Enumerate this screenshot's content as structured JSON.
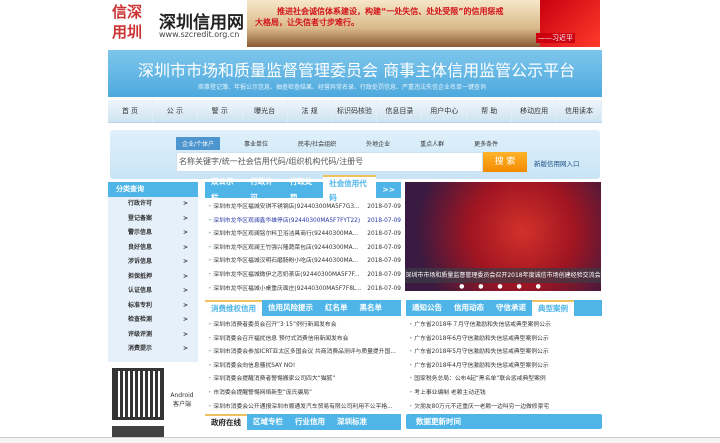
{
  "logo": {
    "seal": "信深用圳",
    "name": "深圳信用网",
    "url": "www.szcredit.org.cn"
  },
  "banner": {
    "line1": "推进社会诚信体系建设，构建“一处失信、处处受限”的信用惩戒",
    "line2": "大格局，让失信者寸步难行。",
    "sign": "——习近平"
  },
  "title": {
    "main": "深圳市市场和质量监督管理委员会 商事主体信用监管公示平台",
    "sub": "商事登记簿、年报公示信息、抽查检查结果、经营异常名录、行政处罚信息、严重违法失信企业名单一键查询"
  },
  "nav": [
    "首 页",
    "公 示",
    "警 示",
    "曝光台",
    "法 规",
    "标识码核验",
    "信息目录",
    "用户中心",
    "帮 助",
    "移动应用",
    "信用读本"
  ],
  "search": {
    "tabs": [
      "企业/个体户",
      "事业单位",
      "民非/社会组织",
      "外地企业",
      "重点人群",
      "更多条件"
    ],
    "placeholder": "名称关键字/统一社会信用代码/组织机构代码/注册号",
    "button": "搜 索",
    "link": "新版信用网入口"
  },
  "sidebar": {
    "header": "分类查询",
    "items": [
      "行政许可",
      "登记备案",
      "警示信息",
      "良好信息",
      "涉诉信息",
      "担保抵押",
      "认证信息",
      "标准专利",
      "检查检测",
      "评级评测",
      "消费提示"
    ],
    "arrow": ">",
    "qr_label": "Android 客户端"
  },
  "publicity": {
    "tabs": [
      "双公示栏",
      "行政许可",
      "行政处罚",
      "社会信用代码",
      ">>"
    ],
    "items": [
      {
        "text": "深圳市龙华区福城安琪不锈钢店(92440300MA5F7G3...",
        "date": "2018-07-09"
      },
      {
        "text": "深圳市龙华区观澜鑫华雄停店(92440300MA5F7FYT22)",
        "date": "2018-07-09"
      },
      {
        "text": "深圳市龙华区观澜铭尔料卫浴洁具商行(92440300MA...",
        "date": "2018-07-09"
      },
      {
        "text": "深圳市龙华区观澜王竹强兴隆蔬菜包店(92440300MA...",
        "date": "2018-07-09"
      },
      {
        "text": "深圳市龙华区福城汉明石磨肠粉小吃店(92440300MA...",
        "date": "2018-07-09"
      },
      {
        "text": "深圳市龙华区福城微伊之恋奶茶店(92440300MA5F7F...",
        "date": "2018-07-09"
      },
      {
        "text": "深圳市龙华区福城小桌重庆面庄(92440300MA5F7F8L...",
        "date": "2018-07-09"
      }
    ]
  },
  "consumer": {
    "tabs": [
      "消费维权信用",
      "信用风险提示",
      "红名单",
      "黑名单"
    ],
    "items": [
      "深圳市消费者委员会召开“3·15”例行新闻发布会",
      "深圳消委会召开福扰信息 预付式消费信用新闻发布会",
      "深圳市消委会参加ICRT亚太区多国会议 共商消费品测评与质量提升国...",
      "深圳消委会向信息骚扰SAY NO!",
      "深圳消委会提醒消费者警惕搬家公司四大“猫腻”",
      "市消委会提醒警惕网络新型“庞氏骗局”",
      "深圳市消委会公开通报深圳市顺通发汽车贸易有限公司利用不公平格..."
    ]
  },
  "gov": {
    "tabs": [
      "政府在线",
      "区域专栏",
      "行业信用",
      "深圳标准"
    ]
  },
  "photo": {
    "caption": "深圳市市场和质量监督管理委员会召开2018年度诚信市场创建经验交流会",
    "dots": "● ● ● ● ●"
  },
  "notice": {
    "tabs": [
      "通知公告",
      "信用动态",
      "守信承诺",
      "典型案例"
    ],
    "items": [
      "广东省2018年７月守信激励和失信惩戒典型案例公示",
      "广东省2018年6月守信激励和失信惩戒典型案例公示",
      "广东省2018年5月守信激励和失信惩戒典型案例公示",
      "广东省2018年4月守信激励和失信惩戒典型案例公示",
      "国家税务总局：公布4起“黑名单”联合惩戒典型案例",
      "考上事业编制 老赖主动还钱",
      "欠朋友80万元不还重庆一老赖一边叫穷一边做修豪宅"
    ]
  },
  "data_update": {
    "header": "数据更新时间"
  }
}
